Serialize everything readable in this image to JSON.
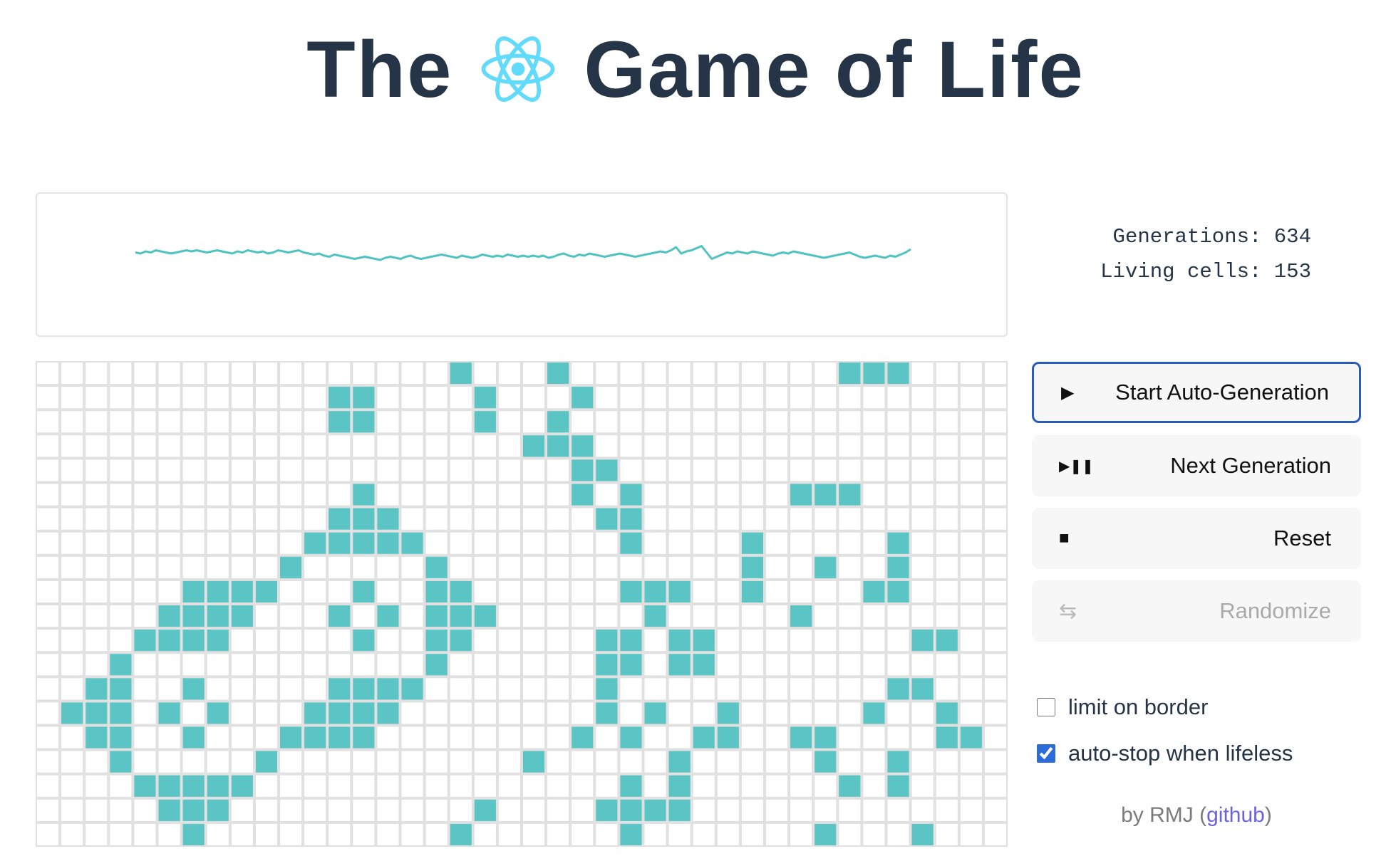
{
  "header": {
    "title_before": "The",
    "title_after": "Game of Life",
    "logo_icon": "react-atom-icon",
    "logo_color": "#61dafb",
    "title_color": "#253447"
  },
  "history_chart": {
    "type": "line",
    "color": "#4fc2c2",
    "note_values": "living cell count per generation (sparkline, no axes)",
    "values": [
      150,
      149,
      151,
      150,
      152,
      151,
      150,
      149,
      150,
      151,
      152,
      151,
      152,
      151,
      150,
      151,
      152,
      151,
      150,
      149,
      151,
      150,
      152,
      151,
      150,
      151,
      149,
      150,
      152,
      151,
      150,
      151,
      152,
      150,
      149,
      148,
      149,
      147,
      146,
      148,
      147,
      146,
      145,
      144,
      145,
      146,
      145,
      144,
      143,
      145,
      146,
      145,
      144,
      146,
      147,
      145,
      144,
      145,
      146,
      147,
      148,
      147,
      146,
      145,
      147,
      146,
      145,
      146,
      148,
      147,
      146,
      147,
      146,
      148,
      147,
      146,
      147,
      146,
      147,
      146,
      147,
      145,
      146,
      148,
      149,
      147,
      146,
      148,
      147,
      149,
      148,
      147,
      146,
      147,
      148,
      149,
      148,
      147,
      146,
      147,
      148,
      149,
      150,
      151,
      150,
      152,
      155,
      149,
      151,
      152,
      154,
      156,
      150,
      144,
      146,
      148,
      150,
      149,
      151,
      150,
      149,
      151,
      150,
      149,
      148,
      147,
      149,
      150,
      149,
      151,
      150,
      149,
      148,
      147,
      146,
      145,
      146,
      147,
      148,
      149,
      150,
      148,
      146,
      145,
      146,
      147,
      146,
      145,
      147,
      146,
      148,
      150,
      153
    ],
    "series": [
      {
        "values": [
          150,
          149,
          151,
          150,
          152,
          151,
          150,
          149,
          150,
          151,
          152,
          151,
          152,
          151,
          150,
          151,
          152,
          151,
          150,
          149,
          151,
          150,
          152,
          151,
          150,
          151,
          149,
          150,
          152,
          151,
          150,
          151,
          152,
          150,
          149,
          148,
          149,
          147,
          146,
          148,
          147,
          146,
          145,
          144,
          145,
          146,
          145,
          144,
          143,
          145,
          146,
          145,
          144,
          146,
          147,
          145,
          144,
          145,
          146,
          147,
          148,
          147,
          146,
          145,
          147,
          146,
          145,
          146,
          148,
          147,
          146,
          147,
          146,
          148,
          147,
          146,
          147,
          146,
          147,
          146,
          147,
          145,
          146,
          148,
          149,
          147,
          146,
          148,
          147,
          149,
          148,
          147,
          146,
          147,
          148,
          149,
          148,
          147,
          146,
          147,
          148,
          149,
          150,
          151,
          150,
          152,
          155,
          149,
          151,
          152,
          154,
          156,
          150,
          144,
          146,
          148,
          150,
          149,
          151,
          150,
          149,
          151,
          150,
          149,
          148,
          147,
          149,
          150,
          149,
          151,
          150,
          149,
          148,
          147,
          146,
          145,
          146,
          147,
          148,
          149,
          150,
          148,
          146,
          145,
          146,
          147,
          146,
          145,
          147,
          146,
          148,
          150,
          153
        ]
      }
    ]
  },
  "stats": {
    "generations_label": "Generations: 634",
    "living_label": "Living cells: 153"
  },
  "grid": {
    "cols": 40,
    "rows": 20,
    "alive_color": "#5bc4c4",
    "dead_color": "#ffffff",
    "line_color": "#e0e0e0",
    "alive_cells": [
      [
        0,
        17
      ],
      [
        0,
        21
      ],
      [
        0,
        33
      ],
      [
        0,
        34
      ],
      [
        0,
        35
      ],
      [
        1,
        12
      ],
      [
        1,
        13
      ],
      [
        1,
        18
      ],
      [
        1,
        22
      ],
      [
        2,
        12
      ],
      [
        2,
        13
      ],
      [
        2,
        18
      ],
      [
        2,
        21
      ],
      [
        3,
        20
      ],
      [
        3,
        21
      ],
      [
        3,
        22
      ],
      [
        4,
        22
      ],
      [
        4,
        23
      ],
      [
        5,
        13
      ],
      [
        5,
        22
      ],
      [
        5,
        24
      ],
      [
        5,
        31
      ],
      [
        5,
        32
      ],
      [
        5,
        33
      ],
      [
        6,
        12
      ],
      [
        6,
        13
      ],
      [
        6,
        14
      ],
      [
        6,
        23
      ],
      [
        6,
        24
      ],
      [
        7,
        11
      ],
      [
        7,
        12
      ],
      [
        7,
        13
      ],
      [
        7,
        14
      ],
      [
        7,
        15
      ],
      [
        7,
        24
      ],
      [
        7,
        29
      ],
      [
        7,
        35
      ],
      [
        8,
        10
      ],
      [
        8,
        16
      ],
      [
        8,
        29
      ],
      [
        8,
        32
      ],
      [
        8,
        35
      ],
      [
        9,
        6
      ],
      [
        9,
        7
      ],
      [
        9,
        8
      ],
      [
        9,
        9
      ],
      [
        9,
        13
      ],
      [
        9,
        16
      ],
      [
        9,
        17
      ],
      [
        9,
        24
      ],
      [
        9,
        25
      ],
      [
        9,
        26
      ],
      [
        9,
        29
      ],
      [
        9,
        34
      ],
      [
        9,
        35
      ],
      [
        10,
        5
      ],
      [
        10,
        6
      ],
      [
        10,
        7
      ],
      [
        10,
        8
      ],
      [
        10,
        12
      ],
      [
        10,
        14
      ],
      [
        10,
        16
      ],
      [
        10,
        17
      ],
      [
        10,
        18
      ],
      [
        10,
        25
      ],
      [
        10,
        31
      ],
      [
        11,
        4
      ],
      [
        11,
        5
      ],
      [
        11,
        6
      ],
      [
        11,
        7
      ],
      [
        11,
        13
      ],
      [
        11,
        16
      ],
      [
        11,
        17
      ],
      [
        11,
        23
      ],
      [
        11,
        24
      ],
      [
        11,
        26
      ],
      [
        11,
        27
      ],
      [
        11,
        36
      ],
      [
        11,
        37
      ],
      [
        12,
        3
      ],
      [
        12,
        16
      ],
      [
        12,
        23
      ],
      [
        12,
        24
      ],
      [
        12,
        26
      ],
      [
        12,
        27
      ],
      [
        13,
        2
      ],
      [
        13,
        3
      ],
      [
        13,
        6
      ],
      [
        13,
        12
      ],
      [
        13,
        13
      ],
      [
        13,
        14
      ],
      [
        13,
        15
      ],
      [
        13,
        23
      ],
      [
        13,
        35
      ],
      [
        13,
        36
      ],
      [
        14,
        1
      ],
      [
        14,
        2
      ],
      [
        14,
        3
      ],
      [
        14,
        5
      ],
      [
        14,
        7
      ],
      [
        14,
        11
      ],
      [
        14,
        12
      ],
      [
        14,
        13
      ],
      [
        14,
        14
      ],
      [
        14,
        23
      ],
      [
        14,
        25
      ],
      [
        14,
        28
      ],
      [
        14,
        34
      ],
      [
        14,
        37
      ],
      [
        15,
        2
      ],
      [
        15,
        3
      ],
      [
        15,
        6
      ],
      [
        15,
        10
      ],
      [
        15,
        11
      ],
      [
        15,
        12
      ],
      [
        15,
        13
      ],
      [
        15,
        22
      ],
      [
        15,
        24
      ],
      [
        15,
        27
      ],
      [
        15,
        28
      ],
      [
        15,
        31
      ],
      [
        15,
        32
      ],
      [
        15,
        37
      ],
      [
        15,
        38
      ],
      [
        16,
        3
      ],
      [
        16,
        9
      ],
      [
        16,
        20
      ],
      [
        16,
        26
      ],
      [
        16,
        32
      ],
      [
        16,
        35
      ],
      [
        17,
        4
      ],
      [
        17,
        5
      ],
      [
        17,
        6
      ],
      [
        17,
        7
      ],
      [
        17,
        8
      ],
      [
        17,
        24
      ],
      [
        17,
        26
      ],
      [
        17,
        33
      ],
      [
        17,
        35
      ],
      [
        18,
        5
      ],
      [
        18,
        6
      ],
      [
        18,
        7
      ],
      [
        18,
        18
      ],
      [
        18,
        23
      ],
      [
        18,
        24
      ],
      [
        18,
        25
      ],
      [
        18,
        26
      ],
      [
        19,
        6
      ],
      [
        19,
        17
      ],
      [
        19,
        24
      ],
      [
        19,
        32
      ],
      [
        19,
        36
      ]
    ]
  },
  "buttons": {
    "start": {
      "label": "Start Auto-Generation",
      "icon": "play-icon"
    },
    "next": {
      "label": "Next Generation",
      "icon": "play-pause-icon"
    },
    "reset": {
      "label": "Reset",
      "icon": "stop-icon"
    },
    "randomize": {
      "label": "Randomize",
      "icon": "shuffle-arrows-icon"
    }
  },
  "options": {
    "limit_border": {
      "label": "limit on border",
      "checked": false
    },
    "auto_stop": {
      "label": "auto-stop when lifeless",
      "checked": true
    }
  },
  "credit": {
    "by": "by RMJ (",
    "link": "github",
    "close": ")"
  }
}
